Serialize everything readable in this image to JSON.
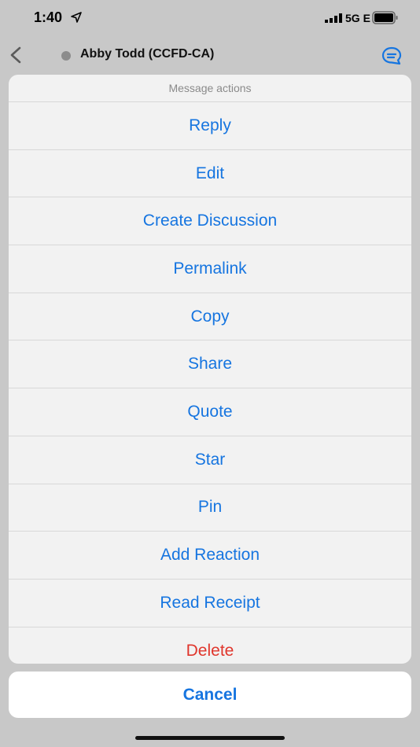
{
  "status_bar": {
    "time": "1:40",
    "network": "5G E",
    "icons": [
      "location-arrow-icon",
      "signal-bars-icon",
      "battery-icon"
    ]
  },
  "nav": {
    "title": "Abby Todd (CCFD-CA)",
    "icons": [
      "chevron-left-icon",
      "presence-dot-icon",
      "thread-chat-icon"
    ]
  },
  "sheet": {
    "header": "Message actions",
    "actions": [
      {
        "label": "Reply"
      },
      {
        "label": "Edit"
      },
      {
        "label": "Create Discussion"
      },
      {
        "label": "Permalink"
      },
      {
        "label": "Copy"
      },
      {
        "label": "Share"
      },
      {
        "label": "Quote"
      },
      {
        "label": "Star"
      },
      {
        "label": "Pin"
      },
      {
        "label": "Add Reaction"
      },
      {
        "label": "Read Receipt"
      },
      {
        "label": "Delete",
        "destructive": true
      }
    ],
    "cancel_label": "Cancel"
  },
  "colors": {
    "action_blue": "#1675e0",
    "destructive_red": "#e0362c",
    "sheet_bg": "#f2f2f2",
    "dimmed_bg": "#c8c8c8"
  }
}
